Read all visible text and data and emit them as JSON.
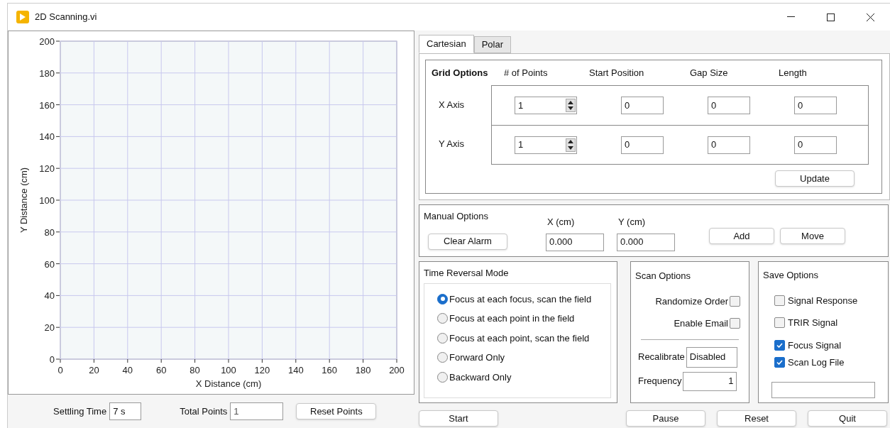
{
  "window": {
    "title": "2D Scanning.vi"
  },
  "plot": {
    "chart_data": {
      "type": "scatter",
      "grid": true,
      "xlabel": "X Distance (cm)",
      "ylabel": "Y Distance (cm)",
      "xlim": [
        0,
        200
      ],
      "ylim": [
        0,
        200
      ],
      "xticks": [
        0,
        20,
        40,
        60,
        80,
        100,
        120,
        140,
        160,
        180,
        200
      ],
      "yticks": [
        0,
        20,
        40,
        60,
        80,
        100,
        120,
        140,
        160,
        180,
        200
      ]
    }
  },
  "settling_time": {
    "label": "Settling Time",
    "value": "7 s"
  },
  "total_points": {
    "label": "Total Points",
    "value": "1",
    "disabled": true
  },
  "reset_points_button": "Reset Points",
  "tabs": [
    {
      "label": "Cartesian",
      "selected": true
    },
    {
      "label": "Polar",
      "selected": false
    }
  ],
  "grid_options": {
    "title": "Grid Options",
    "columns": [
      "# of Points",
      "Start Position",
      "Gap Size",
      "Length"
    ],
    "rows": [
      {
        "label": "X Axis",
        "points": "1",
        "start": "0",
        "gap": "0",
        "length": "0"
      },
      {
        "label": "Y Axis",
        "points": "1",
        "start": "0",
        "gap": "0",
        "length": "0"
      }
    ],
    "update_button": "Update"
  },
  "manual_options": {
    "title": "Manual Options",
    "clear_alarm_button": "Clear Alarm",
    "x": {
      "label": "X (cm)",
      "value": "0.000"
    },
    "y": {
      "label": "Y (cm)",
      "value": "0.000"
    },
    "buttons": [
      "Add",
      "Move"
    ]
  },
  "time_reversal_mode": {
    "title": "Time Reversal Mode",
    "options": [
      {
        "label": "Focus at each focus, scan the field",
        "selected": true
      },
      {
        "label": "Focus at each point in the field",
        "selected": false
      },
      {
        "label": "Focus at each point, scan the field",
        "selected": false
      },
      {
        "label": "Forward Only",
        "selected": false
      },
      {
        "label": "Backward Only",
        "selected": false
      }
    ]
  },
  "scan_options": {
    "title": "Scan Options",
    "checkboxes": [
      {
        "label": "Randomize Order",
        "checked": false
      },
      {
        "label": "Enable Email",
        "checked": false
      }
    ],
    "recalibrate": {
      "label": "Recalibrate",
      "value": "Disabled"
    },
    "frequency": {
      "label": "Frequency",
      "value": "1"
    }
  },
  "save_options": {
    "title": "Save Options",
    "checkboxes": [
      {
        "label": "Signal Response",
        "checked": false
      },
      {
        "label": "TRIR Signal",
        "checked": false
      },
      {
        "label": "Focus Signal",
        "checked": true
      },
      {
        "label": "Scan Log File",
        "checked": true
      }
    ]
  },
  "buttons": [
    "Start",
    "Pause",
    "Reset",
    "Quit"
  ]
}
